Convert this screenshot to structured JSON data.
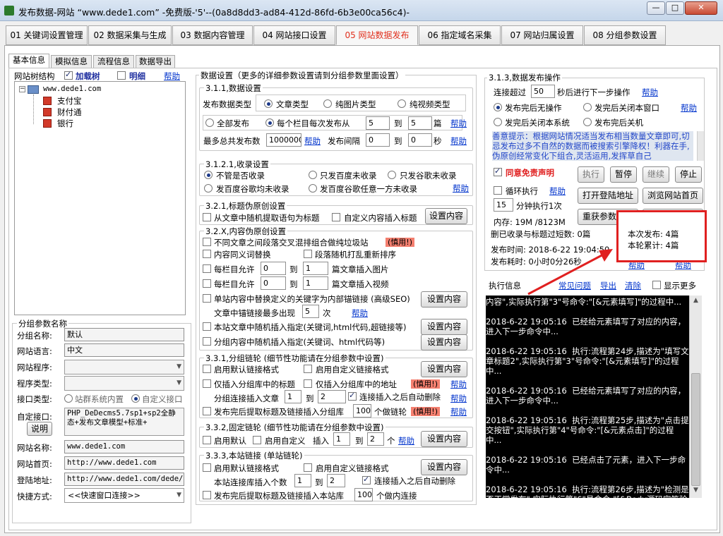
{
  "window": {
    "title": "发布数据-网站 “www.dede1.com” -免费版-'5'--(0a8d8dd3-ad84-412d-86fd-6b3e00ca56c4)-",
    "min": "—",
    "max": "□",
    "close": "✕"
  },
  "main_tabs": [
    "01 关键词设置管理",
    "02 数据采集与生成",
    "03 数据内容管理",
    "04 网站接口设置",
    "05 网站数据发布",
    "06 指定域名采集",
    "07 网站归属设置",
    "08 分组参数设置"
  ],
  "sub_tabs": [
    "基本信息",
    "模拟信息",
    "流程信息",
    "数据导出"
  ],
  "tree": {
    "label": "网站树结构",
    "load_tree": "加载树",
    "detail": "明细",
    "help": "帮助",
    "root": "www.dede1.com",
    "children": [
      "支付宝",
      "财付通",
      "银行"
    ]
  },
  "group_params": {
    "title": "分组参数名称",
    "name_label": "分组名称:",
    "name_value": "默认",
    "lang_label": "网站语言:",
    "lang_value": "中文",
    "program_label": "网站程序:",
    "program_type_label": "程序类型:",
    "iface_label": "接口类型:",
    "iface_opt1": "站群系统内置",
    "iface_opt2": "自定义接口",
    "custom_label": "自定接口:",
    "custom_value": "PHP_DeDecms5.7sp1+sp2全静态+发布文章模型+标准+",
    "explain_btn": "说明",
    "site_name_label": "网站名称:",
    "site_name_value": "www.dede1.com",
    "home_label": "网站首页:",
    "home_value": "http://www.dede1.com",
    "login_label": "登陆地址:",
    "login_value": "http://www.dede1.com/dede/l",
    "shortcut_label": "快捷方式:",
    "shortcut_value": "<<快速窗口连接>>"
  },
  "settings": {
    "title": "数据设置（更多的详细参数设置请到分组参数里面设置）",
    "s311": "3.1.1,数据设置",
    "pub_type_label": "发布数据类型",
    "type_article": "文章类型",
    "type_image": "纯图片类型",
    "type_video": "纯视频类型",
    "all_pub": "全部发布",
    "each_col": "每个栏目每次发布从",
    "from1": "5",
    "to": "到",
    "to1": "5",
    "unit_pian": "篇",
    "help": "帮助",
    "max_total": "最多总共发布数",
    "max_val": "1000000",
    "interval_label": "发布间隔",
    "int_from": "0",
    "int_to": "0",
    "unit_sec": "秒",
    "s3121": "3.1.2.1,收录设置",
    "inc_none": "不管是否收录",
    "inc_baidu": "只发百度未收录",
    "inc_google": "只发谷歌未收录",
    "inc_both": "发百度谷歌均未收录",
    "inc_either": "发百度谷歌任意一方未收录",
    "s321": "3.2.1,标题伪原创设置",
    "t_random": "从文章中随机提取语句为标题",
    "t_custom": "自定义内容插入标题",
    "set_content": "设置内容",
    "s32x": "3.2.X,内容伪原创设置",
    "c_mix": "不同文章之间段落交叉混排组合做纯垃圾站",
    "careful": "(慎用!)",
    "c_syn": "内容同义词替换",
    "c_shuffle": "段落随机打乱重新排序",
    "c_img_pre": "每栏目允许",
    "c_img_from": "0",
    "c_img_to": "1",
    "c_img_post": "篇文章插入图片",
    "c_vid_pre": "每栏目允许",
    "c_vid_from": "0",
    "c_vid_to": "1",
    "c_vid_post": "篇文章插入视频",
    "c_anchor": "单站内容中替换定义的关键字为内部锚链接 (高级SEO)",
    "anchor_max": "文章中锚链接最多出现",
    "anchor_val": "5",
    "anchor_unit": "次",
    "c_site_rand": "本站文章中随机插入指定(关键词,html代码,超链接等)",
    "c_group_rand": "分组内容中随机插入指定(关键词、html代码等)",
    "s331": "3.3.1,分组链轮 (细节性功能请在分组参数中设置)",
    "l_default": "启用默认链接格式",
    "l_custom": "启用自定义链接格式",
    "l_only": "仅插入分组库中的标题",
    "l_only_addr": "仅插入分组库中的地址",
    "l_group_ins": "分组连接插入文章",
    "l_from": "1",
    "l_to": "2",
    "l_auto_del": "连接插入之后自动删除",
    "l_after_pub": "发布完后提取标题及链接插入分组库",
    "l_after_val": "100",
    "l_after_unit": "个做链轮",
    "s332": "3.3.2,固定链轮 (细节性功能请在分组参数中设置)",
    "f_default": "启用默认",
    "f_custom": "启用自定义",
    "f_insert": "插入",
    "f_from": "1",
    "f_to": "2",
    "f_unit": "个",
    "s333": "3.3.3,本站链接 (单站链轮)",
    "s_default": "启用默认链接格式",
    "s_custom": "启用自定义链接格式",
    "s_ins": "本站连接库插入个数",
    "s_from": "1",
    "s_to": "2",
    "s_auto_del": "连接插入之后自动删除",
    "s_after_pub": "发布完后提取标题及链接插入本站库",
    "s_after_val": "100",
    "s_after_unit": "个做内连接"
  },
  "ops": {
    "title": "3.1.3,数据发布操作",
    "conn_pre": "连接超过",
    "conn_val": "50",
    "conn_post": "秒后进行下一步操作",
    "help": "帮助",
    "after_none": "发布完后无操作",
    "after_close_win": "发完后关闭本窗口",
    "after_close_sys": "发完后关闭本系统",
    "after_shutdown": "发布完后关机",
    "tip": "善意提示：根据网站情况适当发布相当数量文章即可,切忌发布过多不自然的数据而被搜索引擎降权！利器在手,伪原创经常变化下组合,灵活运用,发挥草自己",
    "agree": "同意免责声明",
    "exec_btn": "执行",
    "pause_btn": "暂停",
    "continue_btn": "继续",
    "stop_btn": "停止",
    "loop": "循环执行",
    "open_login": "打开登陆地址",
    "browse_home": "浏览网站首页",
    "loop_val": "15",
    "loop_unit": "分钟执行1次",
    "reload": "重获参数设置",
    "close_btn": "关闭",
    "mem": "内存: 19M /8123M",
    "deleted": "删已收录与标题过短数: 0篇",
    "this_pub": "本次发布: 4篇",
    "total_pub": "本轮累计: 4篇",
    "pub_time": "发布时间: 2018-6-22 19:04:50",
    "pub_cost": "发布耗时: 0小时0分26秒"
  },
  "log": {
    "title": "执行信息",
    "faq": "常见问题",
    "export": "导出",
    "clear": "清除",
    "show_more": "显示更多",
    "entries": [
      "内容\",实际执行第\"3\"号命令:\"[&元素填写]\"的过程中...",
      "2018-6-22 19:05:16  已经给元素填写了对应的内容，进入下一步命令中...",
      "2018-6-22 19:05:16  执行:流程第24步,描述为\"填写文章标题2\",实际执行第\"3\"号命令:\"[&元素填写]\"的过程中...",
      "2018-6-22 19:05:16  已经给元素填写了对应的内容，进入下一步命令中...",
      "2018-6-22 19:05:16  执行:流程第25步,描述为\"点击提交按钮\",实际执行第\"4\"号命令:\"[&元素点击]\"的过程中...",
      "2018-6-22 19:05:16  已经点击了元素，进入下一步命令中...",
      "2018-6-22 19:05:16  执行:流程第26步,描述为\"检测是否正常发布\",实际执行第\"6\"号命令:\"[&Body源码字符验证]\"的过程中..."
    ]
  },
  "colors": {
    "active_tab": "#e1301e",
    "link": "#0033cc",
    "warn": "#f47f6f",
    "red_box": "#e02020"
  }
}
